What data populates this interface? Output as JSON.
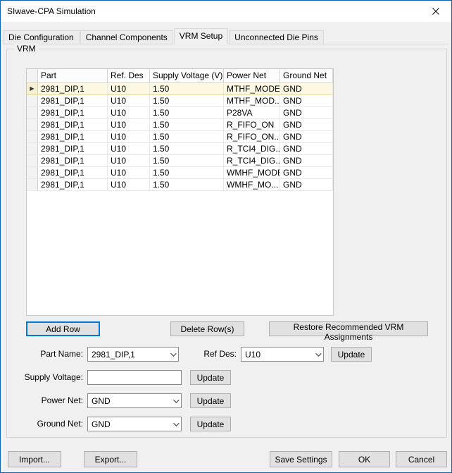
{
  "window": {
    "title": "SIwave-CPA Simulation"
  },
  "tabs": [
    {
      "label": "Die Configuration",
      "active": false
    },
    {
      "label": "Channel Components",
      "active": false
    },
    {
      "label": "VRM Setup",
      "active": true
    },
    {
      "label": "Unconnected Die Pins",
      "active": false
    }
  ],
  "vrm_group": {
    "label": "VRM",
    "table": {
      "columns": [
        "Part",
        "Ref. Des",
        "Supply Voltage (V)",
        "Power Net",
        "Ground Net"
      ],
      "selected_row_index": 0,
      "rows": [
        [
          "2981_DIP,1",
          "U10",
          "1.50",
          "MTHF_MODE",
          "GND"
        ],
        [
          "2981_DIP,1",
          "U10",
          "1.50",
          "MTHF_MOD...",
          "GND"
        ],
        [
          "2981_DIP,1",
          "U10",
          "1.50",
          "P28VA",
          "GND"
        ],
        [
          "2981_DIP,1",
          "U10",
          "1.50",
          "R_FIFO_ON",
          "GND"
        ],
        [
          "2981_DIP,1",
          "U10",
          "1.50",
          "R_FIFO_ON...",
          "GND"
        ],
        [
          "2981_DIP,1",
          "U10",
          "1.50",
          "R_TCI4_DIG...",
          "GND"
        ],
        [
          "2981_DIP,1",
          "U10",
          "1.50",
          "R_TCI4_DIG...",
          "GND"
        ],
        [
          "2981_DIP,1",
          "U10",
          "1.50",
          "WMHF_MODE",
          "GND"
        ],
        [
          "2981_DIP,1",
          "U10",
          "1.50",
          "WMHF_MO...",
          "GND"
        ]
      ]
    },
    "buttons": {
      "add_row": "Add Row",
      "delete_rows": "Delete Row(s)",
      "restore": "Restore Recommended VRM Assignments"
    }
  },
  "form": {
    "part_name": {
      "label": "Part Name:",
      "value": "2981_DIP,1"
    },
    "ref_des": {
      "label": "Ref Des:",
      "value": "U10"
    },
    "supply_voltage": {
      "label": "Supply Voltage:",
      "value": ""
    },
    "power_net": {
      "label": "Power Net:",
      "value": "GND"
    },
    "ground_net": {
      "label": "Ground Net:",
      "value": "GND"
    },
    "update_label": "Update"
  },
  "footer": {
    "import": "Import...",
    "export": "Export...",
    "save_settings": "Save Settings",
    "ok": "OK",
    "cancel": "Cancel"
  }
}
